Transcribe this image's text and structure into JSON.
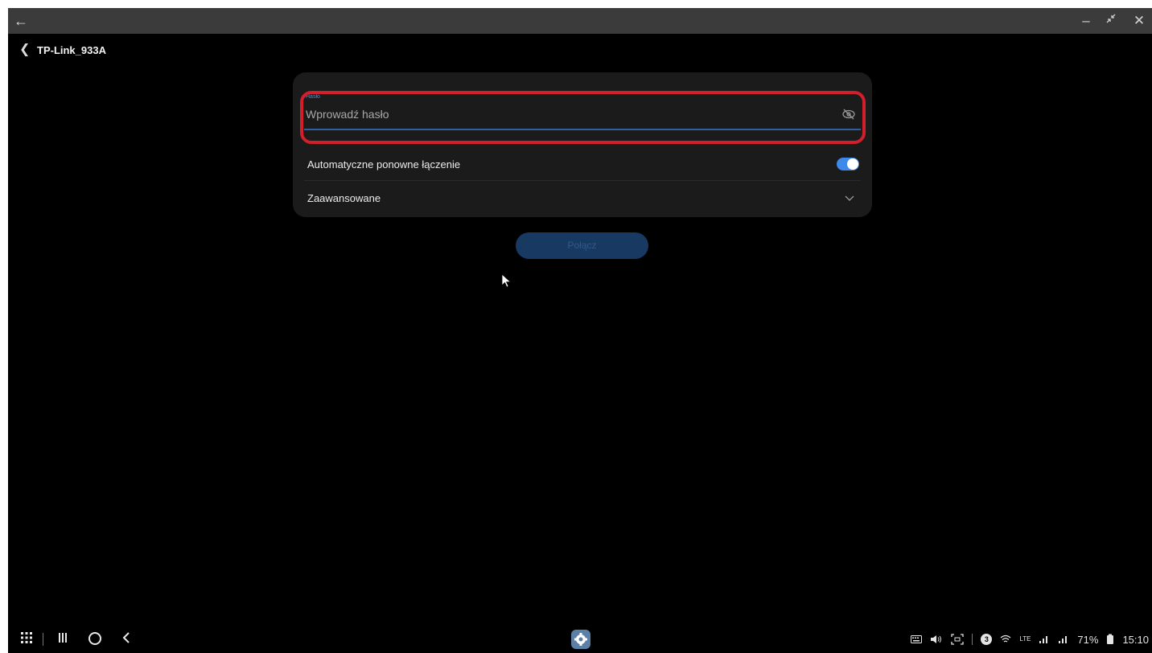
{
  "window": {
    "back_icon": "arrow-left-icon",
    "minimize_icon": "minimize-icon",
    "restore_icon": "restore-icon",
    "close_icon": "close-icon"
  },
  "header": {
    "title": "TP-Link_933A"
  },
  "password": {
    "label": "Hasło",
    "placeholder": "Wprowadź hasło",
    "value": ""
  },
  "settings": {
    "auto_reconnect_label": "Automatyczne ponowne łączenie",
    "auto_reconnect_on": true,
    "advanced_label": "Zaawansowane"
  },
  "connect_button": {
    "label": "Połącz",
    "enabled": false
  },
  "status_bar": {
    "notification_count": "3",
    "network_label": "LTE",
    "battery": "71%",
    "time": "15:10"
  },
  "colors": {
    "accent": "#3e89ea",
    "highlight": "#d11f2b",
    "background": "#000000",
    "card": "#1b1b1b"
  }
}
